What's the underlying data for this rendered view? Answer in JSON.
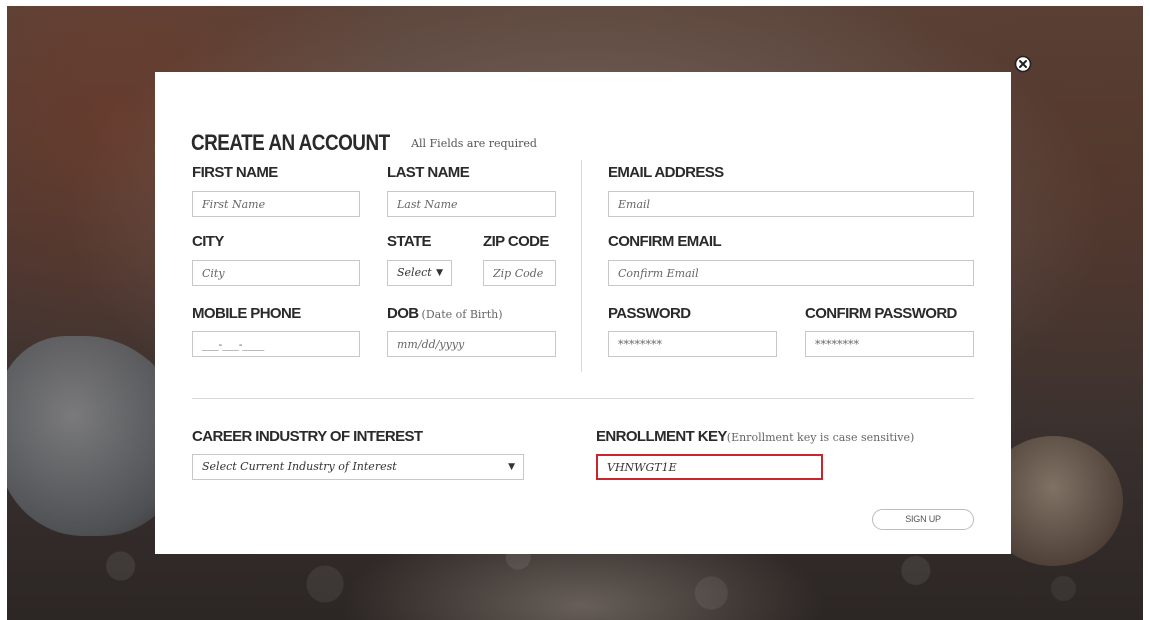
{
  "form": {
    "title": "CREATE AN ACCOUNT",
    "subtitle": "All Fields are required",
    "first_name": {
      "label": "FIRST NAME",
      "placeholder": "First Name"
    },
    "last_name": {
      "label": "LAST NAME",
      "placeholder": "Last Name"
    },
    "email": {
      "label": "EMAIL ADDRESS",
      "placeholder": "Email"
    },
    "city": {
      "label": "CITY",
      "placeholder": "City"
    },
    "state": {
      "label": "STATE",
      "value": "Select"
    },
    "zip": {
      "label": "ZIP CODE",
      "placeholder": "Zip Code"
    },
    "confirm_email": {
      "label": "CONFIRM EMAIL",
      "placeholder": "Confirm Email"
    },
    "mobile_phone": {
      "label": "MOBILE PHONE",
      "placeholder": "___-___-____"
    },
    "dob": {
      "label": "DOB",
      "note": "(Date of Birth)",
      "placeholder": "mm/dd/yyyy"
    },
    "password": {
      "label": "PASSWORD",
      "placeholder": "********"
    },
    "confirm_password": {
      "label": "CONFIRM PASSWORD",
      "placeholder": "********"
    },
    "career": {
      "label": "CAREER INDUSTRY OF INTEREST",
      "value": "Select Current Industry of Interest"
    },
    "enrollment": {
      "label": "ENROLLMENT KEY",
      "note": "(Enrollment key is case sensitive)",
      "value": "VHNWGT1E"
    },
    "signup_label": "SIGN UP"
  },
  "icons": {
    "close": "close-circle-icon",
    "caret": "caret-down-icon"
  },
  "colors": {
    "error_border": "#c9252c",
    "heading": "#2a2a2a"
  }
}
